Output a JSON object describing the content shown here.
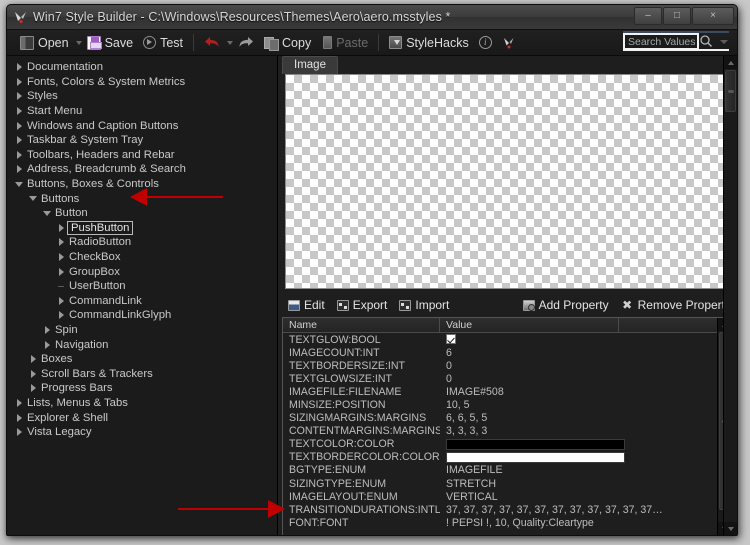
{
  "window": {
    "title": "Win7 Style Builder - C:\\Windows\\Resources\\Themes\\Aero\\aero.msstyles *",
    "app_icon": "app-logo-icon",
    "minimize": "–",
    "maximize": "□",
    "close": "×"
  },
  "toolbar": {
    "open_label": "Open",
    "save_label": "Save",
    "test_label": "Test",
    "copy_label": "Copy",
    "paste_label": "Paste",
    "stylehacks_label": "StyleHacks",
    "undo_icon": "undo-arrow-icon",
    "redo_icon": "redo-arrow-icon",
    "info_icon": "i",
    "bird_icon": "bird-logo-icon"
  },
  "search": {
    "placeholder": "Search Values",
    "value": "",
    "icon": "magnifier-icon"
  },
  "tree": {
    "nodes": [
      {
        "label": "Documentation",
        "indent": 0,
        "state": "closed"
      },
      {
        "label": "Fonts, Colors & System Metrics",
        "indent": 0,
        "state": "closed"
      },
      {
        "label": "Styles",
        "indent": 0,
        "state": "closed"
      },
      {
        "label": "Start Menu",
        "indent": 0,
        "state": "closed"
      },
      {
        "label": "Windows and Caption Buttons",
        "indent": 0,
        "state": "closed"
      },
      {
        "label": "Taskbar & System Tray",
        "indent": 0,
        "state": "closed"
      },
      {
        "label": "Toolbars, Headers and Rebar",
        "indent": 0,
        "state": "closed"
      },
      {
        "label": "Address, Breadcrumb & Search",
        "indent": 0,
        "state": "closed"
      },
      {
        "label": "Buttons, Boxes & Controls",
        "indent": 0,
        "state": "open"
      },
      {
        "label": "Buttons",
        "indent": 1,
        "state": "open"
      },
      {
        "label": "Button",
        "indent": 2,
        "state": "open"
      },
      {
        "label": "PushButton",
        "indent": 3,
        "state": "closed",
        "selected": true
      },
      {
        "label": "RadioButton",
        "indent": 3,
        "state": "closed"
      },
      {
        "label": "CheckBox",
        "indent": 3,
        "state": "closed"
      },
      {
        "label": "GroupBox",
        "indent": 3,
        "state": "closed"
      },
      {
        "label": "UserButton",
        "indent": 3,
        "state": "leaf"
      },
      {
        "label": "CommandLink",
        "indent": 3,
        "state": "closed"
      },
      {
        "label": "CommandLinkGlyph",
        "indent": 3,
        "state": "closed"
      },
      {
        "label": "Spin",
        "indent": 2,
        "state": "closed"
      },
      {
        "label": "Navigation",
        "indent": 2,
        "state": "closed"
      },
      {
        "label": "Boxes",
        "indent": 1,
        "state": "closed"
      },
      {
        "label": "Scroll Bars & Trackers",
        "indent": 1,
        "state": "closed"
      },
      {
        "label": "Progress Bars",
        "indent": 1,
        "state": "closed"
      },
      {
        "label": "Lists, Menus & Tabs",
        "indent": 0,
        "state": "closed"
      },
      {
        "label": "Explorer & Shell",
        "indent": 0,
        "state": "closed"
      },
      {
        "label": "Vista Legacy",
        "indent": 0,
        "state": "closed"
      }
    ]
  },
  "preview": {
    "tab_label": "Image"
  },
  "prop_toolbar": {
    "edit_label": "Edit",
    "export_label": "Export",
    "import_label": "Import",
    "add_property_label": "Add Property",
    "remove_property_label": "Remove Property"
  },
  "grid": {
    "columns": [
      "Name",
      "Value"
    ],
    "rows": [
      {
        "name": "TEXTGLOW:BOOL",
        "value": "",
        "type": "checkbox",
        "checked": true
      },
      {
        "name": "IMAGECOUNT:INT",
        "value": "6",
        "type": "text"
      },
      {
        "name": "TEXTBORDERSIZE:INT",
        "value": "0",
        "type": "text"
      },
      {
        "name": "TEXTGLOWSIZE:INT",
        "value": "0",
        "type": "text"
      },
      {
        "name": "IMAGEFILE:FILENAME",
        "value": "IMAGE#508",
        "type": "text"
      },
      {
        "name": "MINSIZE:POSITION",
        "value": "10, 5",
        "type": "text"
      },
      {
        "name": "SIZINGMARGINS:MARGINS",
        "value": "6, 6, 5, 5",
        "type": "text"
      },
      {
        "name": "CONTENTMARGINS:MARGINS",
        "value": "3, 3, 3, 3",
        "type": "text"
      },
      {
        "name": "TEXTCOLOR:COLOR",
        "value": "",
        "type": "swatch",
        "color": "#000000"
      },
      {
        "name": "TEXTBORDERCOLOR:COLOR",
        "value": "",
        "type": "swatch",
        "color": "#ffffff"
      },
      {
        "name": "BGTYPE:ENUM",
        "value": "IMAGEFILE",
        "type": "text"
      },
      {
        "name": "SIZINGTYPE:ENUM",
        "value": "STRETCH",
        "type": "text"
      },
      {
        "name": "IMAGELAYOUT:ENUM",
        "value": "VERTICAL",
        "type": "text"
      },
      {
        "name": "TRANSITIONDURATIONS:INTLIST",
        "value": "37, 37, 37, 37, 37, 37, 37, 37, 37, 37, 37, 37…",
        "type": "text"
      },
      {
        "name": "FONT:FONT",
        "value": "! PEPSI !, 10, Quality:Cleartype",
        "type": "text"
      }
    ]
  },
  "annotations": [
    {
      "name": "arrow-pointing-to-pushbutton",
      "direction": "left"
    },
    {
      "name": "arrow-pointing-to-font-row",
      "direction": "right"
    }
  ],
  "colors": {
    "accent_red": "#c00000",
    "window_bg": "#1e1e1e",
    "titlebar": "#3c3c3c"
  }
}
